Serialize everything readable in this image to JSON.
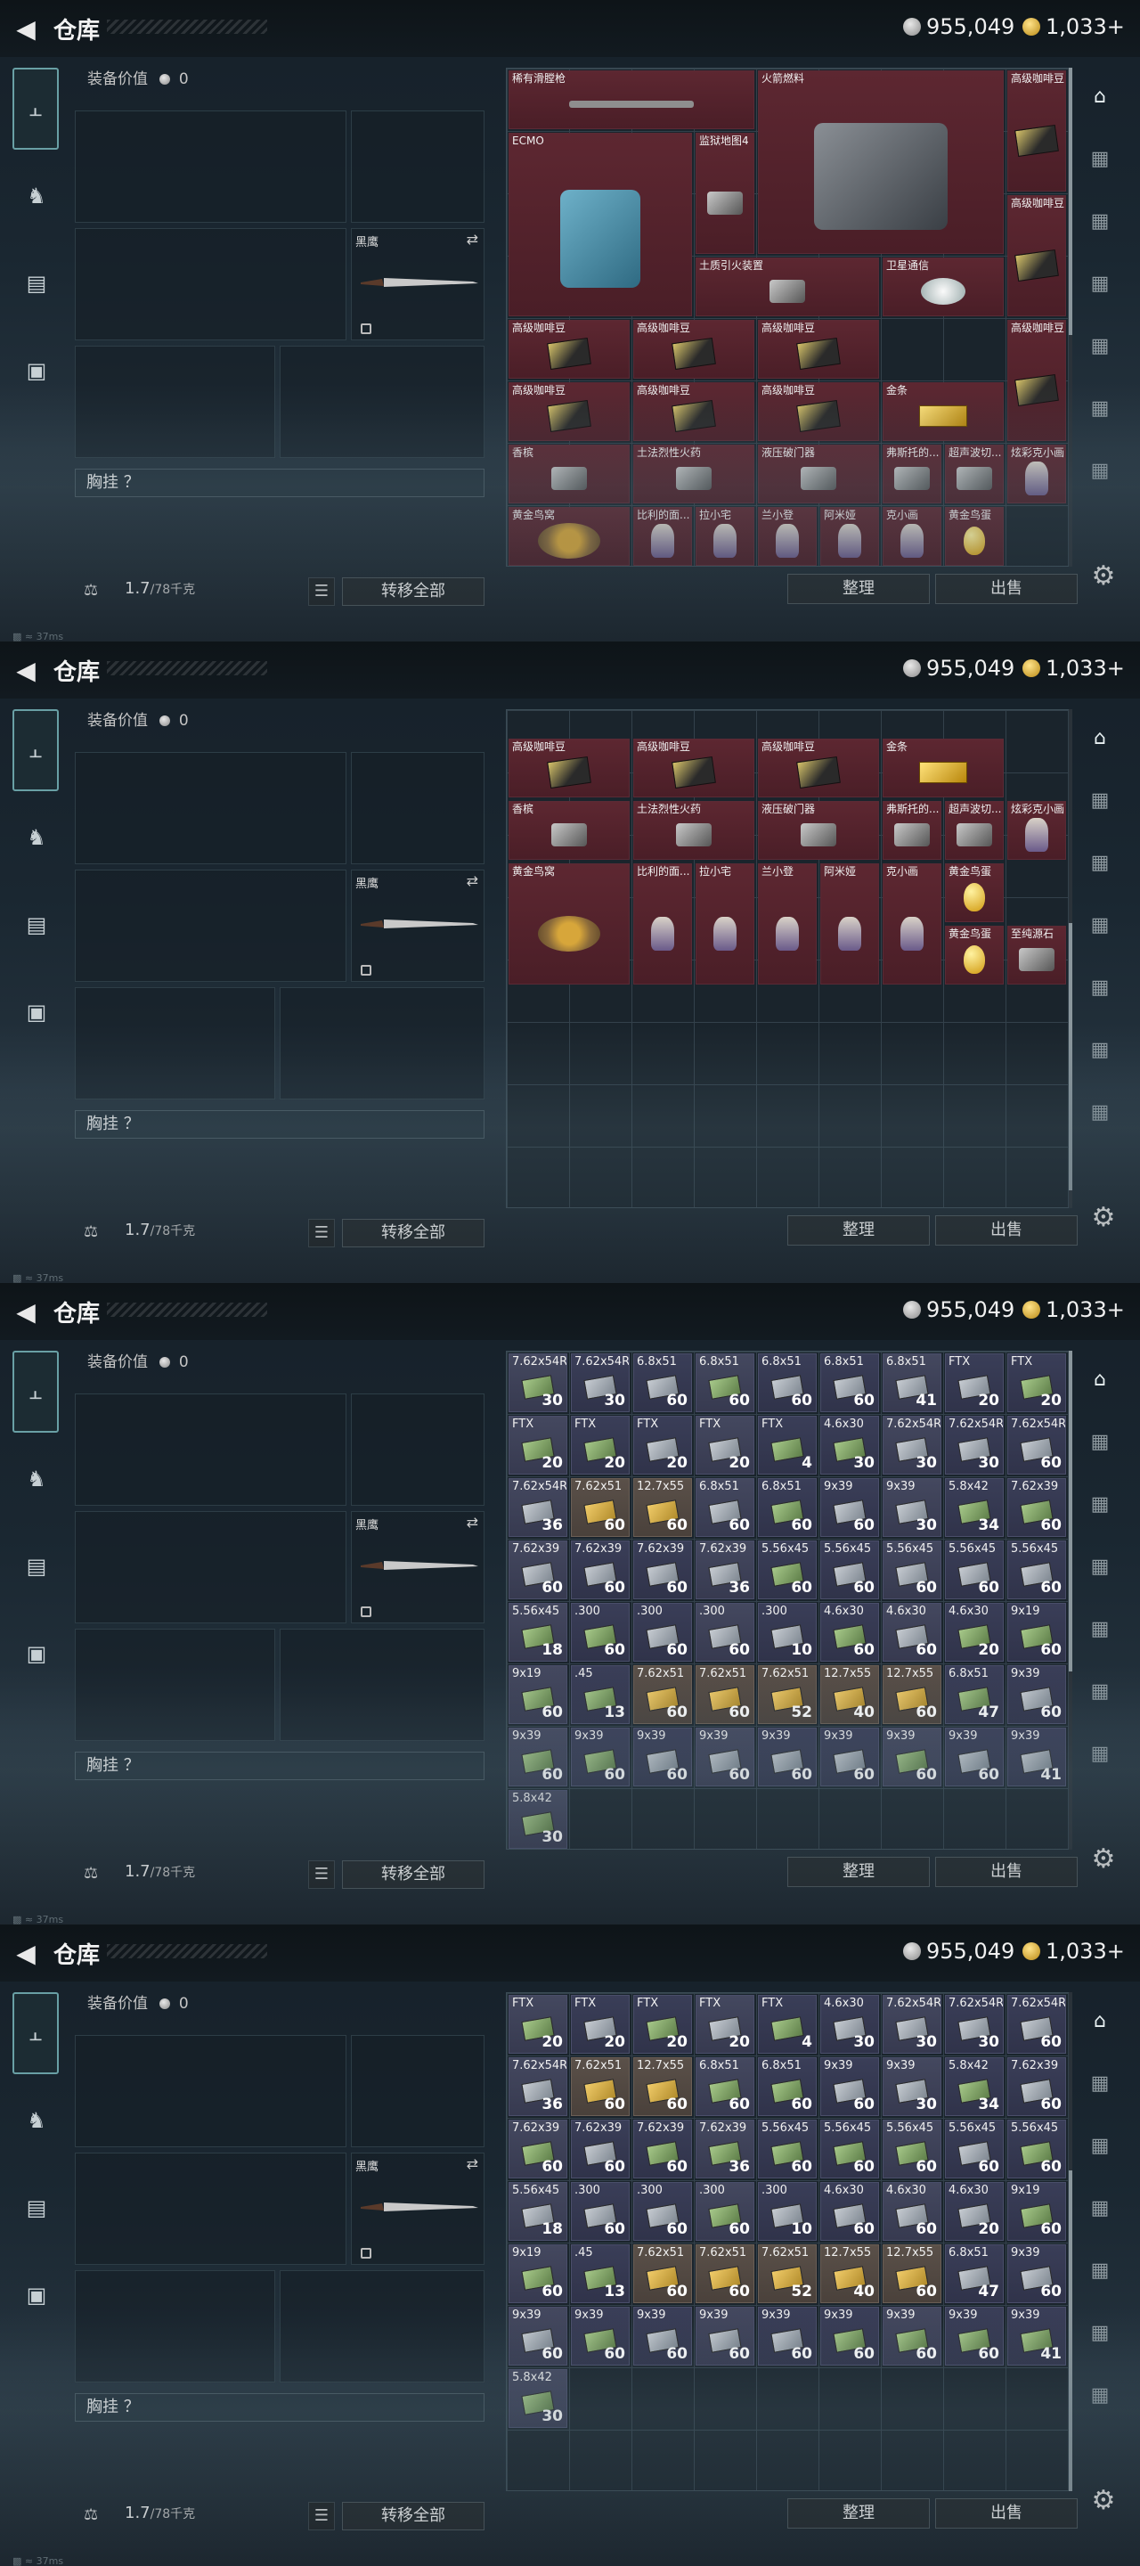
{
  "header": {
    "title": "仓库",
    "silver": "955,049",
    "gold": "1,033+",
    "status": "37ms"
  },
  "equipment": {
    "value_label": "装备价值",
    "value": "0",
    "knife_name": "黑鹰",
    "vest_label": "胸挂 ？"
  },
  "bottom": {
    "weight": "1.7",
    "weight_max": "/78千克",
    "transfer_all": "转移全部",
    "sort": "整理",
    "sell": "出售"
  },
  "panel1": {
    "items": [
      {
        "name": "稀有滑膛枪"
      },
      {
        "name": "火箭燃料"
      },
      {
        "name": "高级咖啡豆"
      },
      {
        "name": "ECMO"
      },
      {
        "name": "监狱地图4"
      },
      {
        "name": "高级咖啡豆"
      },
      {
        "name": "土质引火装置"
      },
      {
        "name": "卫星通信"
      },
      {
        "name": "高级咖啡豆"
      },
      {
        "name": "高级咖啡豆"
      },
      {
        "name": "高级咖啡豆"
      },
      {
        "name": "高级咖啡豆"
      },
      {
        "name": "高级咖啡豆"
      },
      {
        "name": "高级咖啡豆"
      },
      {
        "name": "高级咖啡豆"
      },
      {
        "name": "金条"
      },
      {
        "name": "香槟"
      },
      {
        "name": "土法烈性火药"
      },
      {
        "name": "液压破门器"
      },
      {
        "name": "弗斯托的..."
      },
      {
        "name": "超声波切..."
      },
      {
        "name": "炫彩克小画"
      },
      {
        "name": "黄金鸟窝"
      },
      {
        "name": "比利的面..."
      },
      {
        "name": "拉小宅"
      },
      {
        "name": "兰小登"
      },
      {
        "name": "阿米娅"
      },
      {
        "name": "克小画"
      },
      {
        "name": "黄金鸟蛋"
      }
    ]
  },
  "panel2": {
    "items": [
      {
        "name": "高级咖啡豆"
      },
      {
        "name": "高级咖啡豆"
      },
      {
        "name": "高级咖啡豆"
      },
      {
        "name": "金条"
      },
      {
        "name": "香槟"
      },
      {
        "name": "土法烈性火药"
      },
      {
        "name": "液压破门器"
      },
      {
        "name": "弗斯托的..."
      },
      {
        "name": "超声波切..."
      },
      {
        "name": "炫彩克小画"
      },
      {
        "name": "黄金鸟窝"
      },
      {
        "name": "比利的面..."
      },
      {
        "name": "拉小宅"
      },
      {
        "name": "兰小登"
      },
      {
        "name": "阿米娅"
      },
      {
        "name": "克小画"
      },
      {
        "name": "黄金鸟蛋"
      },
      {
        "name": "黄金鸟蛋"
      },
      {
        "name": "至纯源石"
      }
    ]
  },
  "panel3": {
    "ammo": [
      [
        "7.62x54R",
        "30"
      ],
      [
        "7.62x54R",
        "30"
      ],
      [
        "6.8x51",
        "60"
      ],
      [
        "6.8x51",
        "60"
      ],
      [
        "6.8x51",
        "60"
      ],
      [
        "6.8x51",
        "60"
      ],
      [
        "6.8x51",
        "41"
      ],
      [
        "FTX",
        "20"
      ],
      [
        "FTX",
        "20"
      ],
      [
        "FTX",
        "20"
      ],
      [
        "FTX",
        "20"
      ],
      [
        "FTX",
        "20"
      ],
      [
        "FTX",
        "20"
      ],
      [
        "FTX",
        "4"
      ],
      [
        "4.6x30",
        "30"
      ],
      [
        "7.62x54R",
        "30"
      ],
      [
        "7.62x54R",
        "30"
      ],
      [
        "7.62x54R",
        "60"
      ],
      [
        "7.62x54R",
        "36"
      ],
      [
        "7.62x51",
        "60"
      ],
      [
        "12.7x55",
        "60"
      ],
      [
        "6.8x51",
        "60"
      ],
      [
        "6.8x51",
        "60"
      ],
      [
        "9x39",
        "60"
      ],
      [
        "9x39",
        "30"
      ],
      [
        "5.8x42",
        "34"
      ],
      [
        "7.62x39",
        "60"
      ],
      [
        "7.62x39",
        "60"
      ],
      [
        "7.62x39",
        "60"
      ],
      [
        "7.62x39",
        "60"
      ],
      [
        "7.62x39",
        "36"
      ],
      [
        "5.56x45",
        "60"
      ],
      [
        "5.56x45",
        "60"
      ],
      [
        "5.56x45",
        "60"
      ],
      [
        "5.56x45",
        "60"
      ],
      [
        "5.56x45",
        "60"
      ],
      [
        "5.56x45",
        "18"
      ],
      [
        ".300",
        "60"
      ],
      [
        ".300",
        "60"
      ],
      [
        ".300",
        "60"
      ],
      [
        ".300",
        "10"
      ],
      [
        "4.6x30",
        "60"
      ],
      [
        "4.6x30",
        "60"
      ],
      [
        "4.6x30",
        "20"
      ],
      [
        "9x19",
        "60"
      ],
      [
        "9x19",
        "60"
      ],
      [
        ".45",
        "13"
      ],
      [
        "7.62x51",
        "60"
      ],
      [
        "7.62x51",
        "60"
      ],
      [
        "7.62x51",
        "52"
      ],
      [
        "12.7x55",
        "40"
      ],
      [
        "12.7x55",
        "60"
      ],
      [
        "6.8x51",
        "47"
      ],
      [
        "9x39",
        "60"
      ],
      [
        "9x39",
        "60"
      ],
      [
        "9x39",
        "60"
      ],
      [
        "9x39",
        "60"
      ],
      [
        "9x39",
        "60"
      ],
      [
        "9x39",
        "60"
      ],
      [
        "9x39",
        "60"
      ],
      [
        "9x39",
        "60"
      ],
      [
        "9x39",
        "60"
      ],
      [
        "9x39",
        "41"
      ],
      [
        "5.8x42",
        "30"
      ]
    ]
  }
}
